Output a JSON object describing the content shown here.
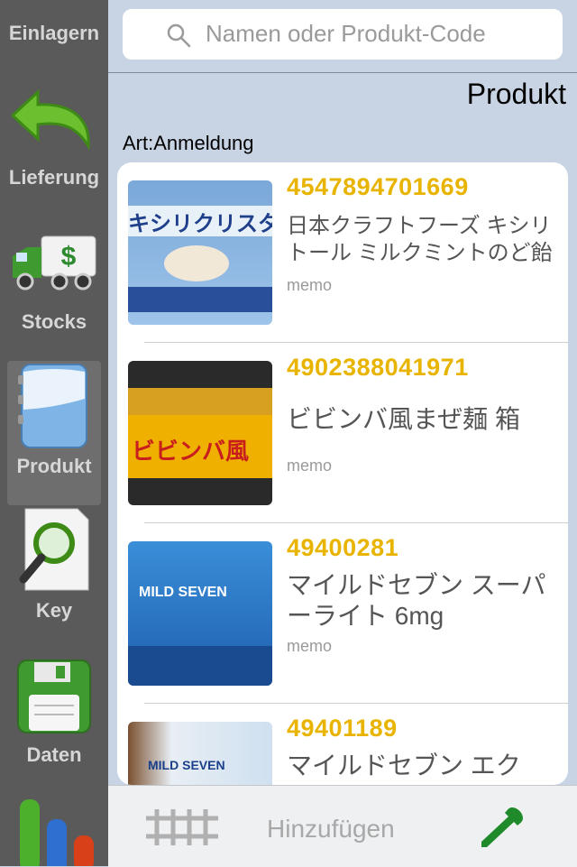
{
  "sidebar": {
    "items": [
      {
        "label": "Einlagern",
        "icon": "einlagern-icon"
      },
      {
        "label": "Lieferung",
        "icon": "undo-arrow-icon"
      },
      {
        "label": "Stocks",
        "icon": "truck-dollar-icon"
      },
      {
        "label": "Produkt",
        "icon": "notebook-icon",
        "active": true
      },
      {
        "label": "Key",
        "icon": "magnifier-document-icon"
      },
      {
        "label": "Daten",
        "icon": "floppy-disk-icon"
      },
      {
        "label": "",
        "icon": "bar-chart-icon"
      }
    ]
  },
  "search": {
    "placeholder": "Namen oder Produkt-Code"
  },
  "header": {
    "title": "Produkt"
  },
  "section": {
    "label": "Art:Anmeldung"
  },
  "products": [
    {
      "code": "4547894701669",
      "name": "日本クラフトフーズ キシリトール ミルクミントのど飴",
      "memo": "memo",
      "thumb_text": "キシリクリスタル"
    },
    {
      "code": "4902388041971",
      "name": "ビビンバ風まぜ麺 箱",
      "memo": "memo",
      "thumb_text": "ビビンバ風"
    },
    {
      "code": "49400281",
      "name": "マイルドセブン スーパーライト 6mg",
      "memo": "memo",
      "thumb_text": "MILD SEVEN"
    },
    {
      "code": "49401189",
      "name": "マイルドセブン エク",
      "memo": "",
      "thumb_text": "MILD SEVEN"
    }
  ],
  "bottombar": {
    "add_label": "Hinzufügen"
  },
  "colors": {
    "code": "#e8b400",
    "accent_green": "#2e9a2e",
    "sidebar_bg": "#5a5a5a"
  }
}
